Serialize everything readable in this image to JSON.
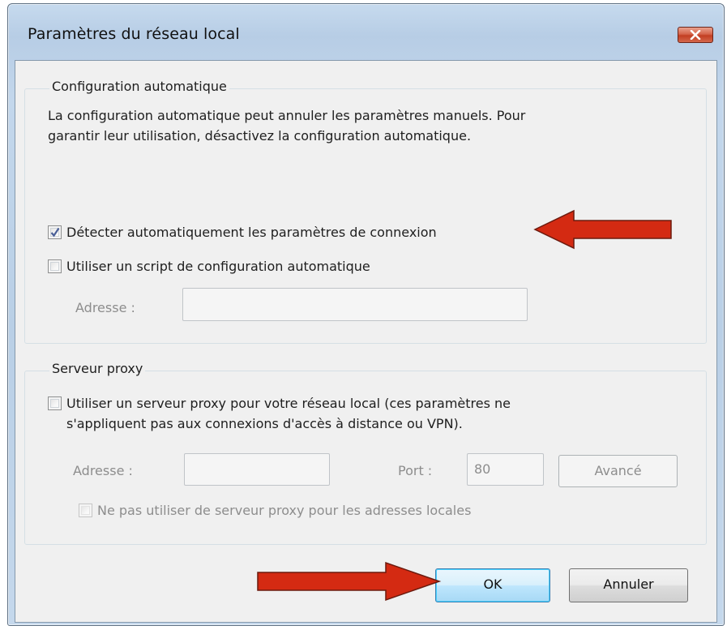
{
  "window": {
    "title": "Paramètres du réseau local",
    "close_icon": "close-icon"
  },
  "auto_config": {
    "legend": "Configuration automatique",
    "description_line1": "La configuration automatique peut annuler les paramètres manuels. Pour",
    "description_line2": "garantir leur utilisation, désactivez la configuration automatique.",
    "detect_label": "Détecter automatiquement les paramètres de connexion",
    "detect_checked": true,
    "script_label": "Utiliser un script de configuration automatique",
    "script_checked": false,
    "address_label": "Adresse :",
    "address_value": ""
  },
  "proxy": {
    "legend": "Serveur proxy",
    "use_proxy_line1": "Utiliser un serveur proxy pour votre réseau local (ces paramètres ne",
    "use_proxy_line2": "s'appliquent pas aux connexions d'accès à distance ou VPN).",
    "use_proxy_checked": false,
    "address_label": "Adresse :",
    "address_value": "",
    "port_label": "Port :",
    "port_value": "80",
    "advanced_button": "Avancé",
    "bypass_label": "Ne pas utiliser de serveur proxy pour les adresses locales",
    "bypass_checked": false
  },
  "buttons": {
    "ok": "OK",
    "cancel": "Annuler"
  },
  "annotations": {
    "arrow_color": "#d42a12",
    "arrow_icon": "red-arrow-icon"
  }
}
